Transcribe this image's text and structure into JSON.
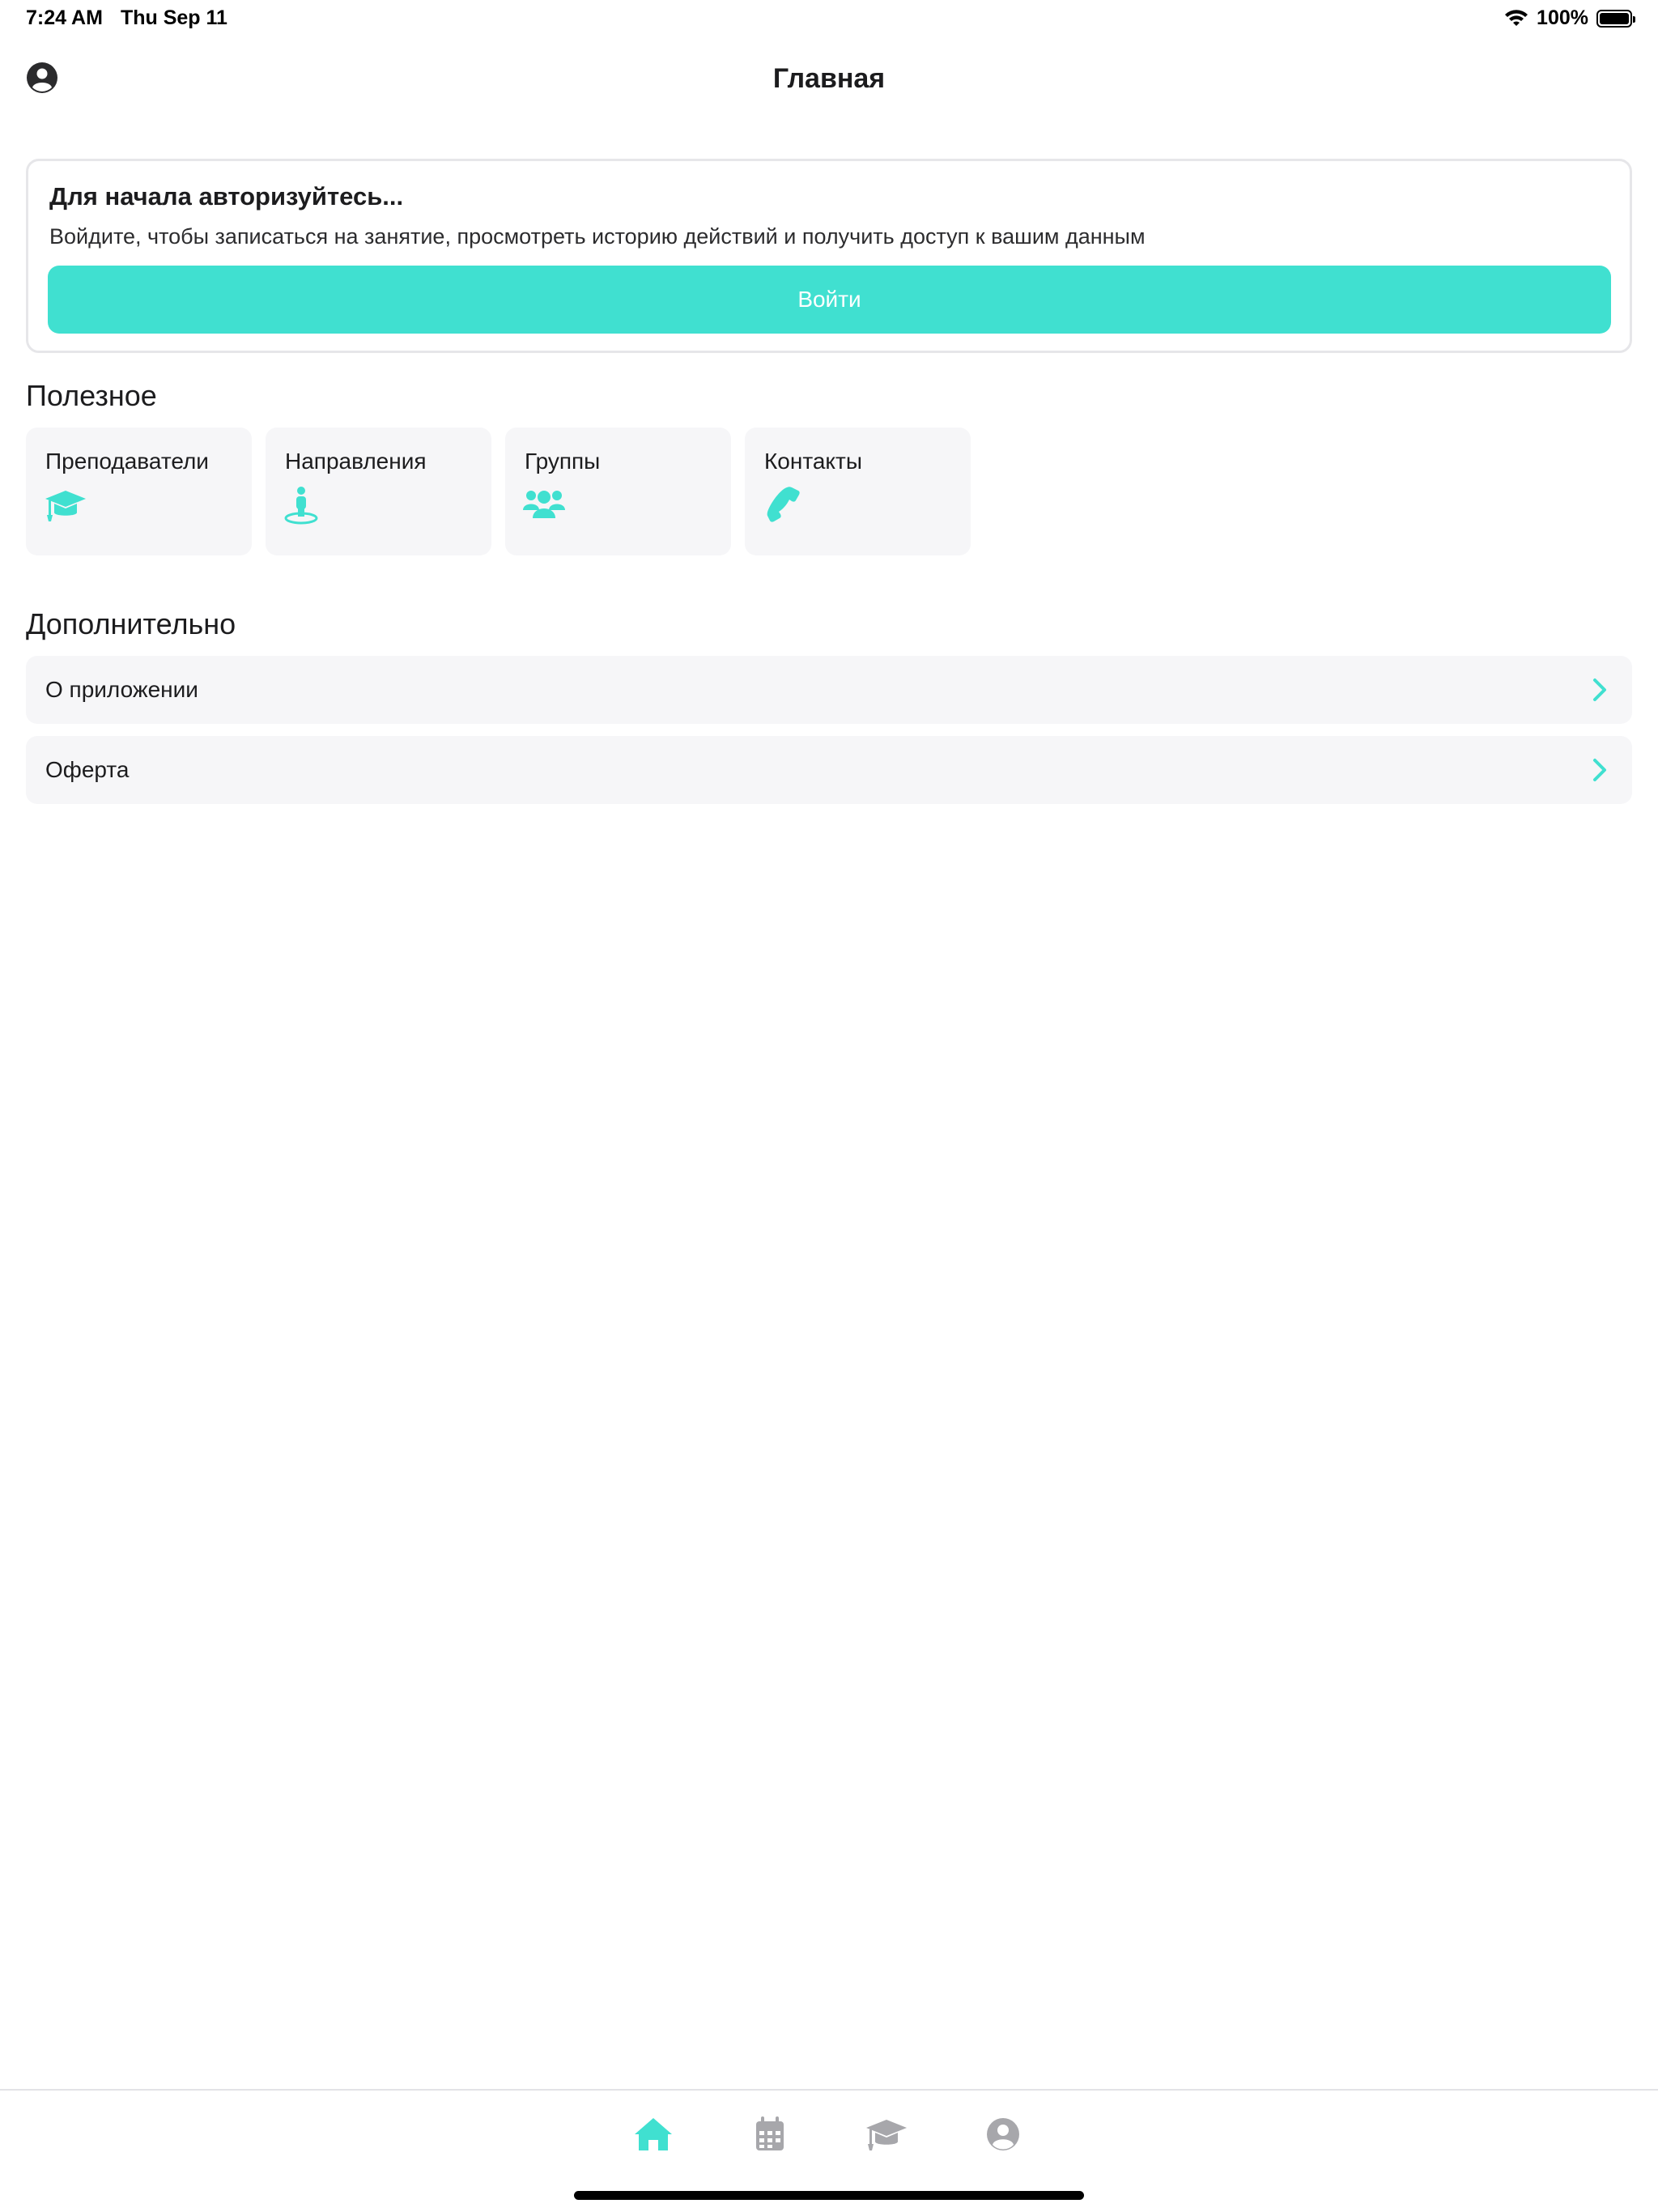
{
  "status_bar": {
    "time": "7:24 AM",
    "date": "Thu Sep 11",
    "battery_percent": "100%",
    "icons": [
      "wifi-icon",
      "battery-icon"
    ]
  },
  "header": {
    "title": "Главная",
    "left_icon": "user-circle-icon"
  },
  "auth_card": {
    "title": "Для начала авторизуйтесь...",
    "description": "Войдите, чтобы записаться на занятие, просмотреть историю действий и получить доступ к вашим данным",
    "button_label": "Войти"
  },
  "useful": {
    "title": "Полезное",
    "tiles": [
      {
        "label": "Преподаватели",
        "icon": "graduation-cap-icon"
      },
      {
        "label": "Направления",
        "icon": "street-view-icon"
      },
      {
        "label": "Группы",
        "icon": "users-icon"
      },
      {
        "label": "Контакты",
        "icon": "phone-icon"
      }
    ]
  },
  "extra": {
    "title": "Дополнительно",
    "items": [
      {
        "label": "О приложении",
        "icon": "chevron-right-icon"
      },
      {
        "label": "Оферта",
        "icon": "chevron-right-icon"
      }
    ]
  },
  "tab_bar": {
    "tabs": [
      {
        "icon": "home-icon",
        "active": true
      },
      {
        "icon": "calendar-icon",
        "active": false
      },
      {
        "icon": "graduation-cap-icon",
        "active": false
      },
      {
        "icon": "user-circle-icon",
        "active": false
      }
    ]
  },
  "colors": {
    "accent": "#40e0d0",
    "tile_background": "#f6f6f8",
    "inactive_tab": "#a7a7ab",
    "text": "#1c1c1e"
  }
}
